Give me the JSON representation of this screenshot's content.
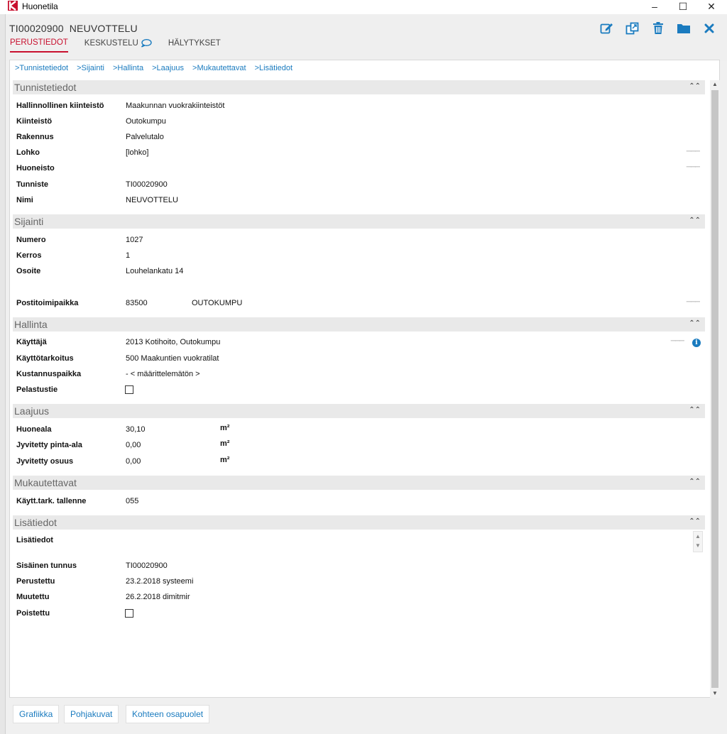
{
  "window": {
    "title": "Huonetila",
    "minimize": "–",
    "maximize": "☐",
    "close": "✕"
  },
  "record": {
    "code": "TI00020900",
    "name": "NEUVOTTELU"
  },
  "tabs": [
    "PERUSTIEDOT",
    "KESKUSTELU",
    "HÄLYTYKSET"
  ],
  "anchors": [
    ">Tunnistetiedot",
    ">Sijainti",
    ">Hallinta",
    ">Laajuus",
    ">Mukautettavat",
    ">Lisätiedot"
  ],
  "sections": {
    "tunnistetiedot": {
      "title": "Tunnistetiedot",
      "rows": [
        {
          "label": "Hallinnollinen kiinteistö",
          "value": "Maakunnan vuokrakiinteistöt"
        },
        {
          "label": "Kiinteistö",
          "value": "Outokumpu"
        },
        {
          "label": "Rakennus",
          "value": "Palvelutalo"
        },
        {
          "label": "Lohko",
          "value": "[lohko]"
        },
        {
          "label": "Huoneisto",
          "value": ""
        },
        {
          "label": "Tunniste",
          "value": "TI00020900"
        },
        {
          "label": "Nimi",
          "value": "NEUVOTTELU"
        }
      ]
    },
    "sijainti": {
      "title": "Sijainti",
      "rows": [
        {
          "label": "Numero",
          "value": "1027"
        },
        {
          "label": "Kerros",
          "value": "1"
        },
        {
          "label": "Osoite",
          "value": "Louhelankatu 14"
        },
        {
          "label": "Postitoimipaikka",
          "value": "83500",
          "value2": "OUTOKUMPU"
        }
      ]
    },
    "hallinta": {
      "title": "Hallinta",
      "rows": [
        {
          "label": "Käyttäjä",
          "value": "2013 Kotihoito, Outokumpu"
        },
        {
          "label": "Käyttötarkoitus",
          "value": "500 Maakuntien vuokratilat"
        },
        {
          "label": "Kustannuspaikka",
          "value": "- < määrittelemätön >"
        },
        {
          "label": "Pelastustie",
          "value": ""
        }
      ]
    },
    "laajuus": {
      "title": "Laajuus",
      "rows": [
        {
          "label": "Huoneala",
          "value": "30,10",
          "unit": "m²"
        },
        {
          "label": "Jyvitetty pinta-ala",
          "value": "0,00",
          "unit": "m²"
        },
        {
          "label": "Jyvitetty osuus",
          "value": "0,00",
          "unit": "m²"
        }
      ]
    },
    "mukautettavat": {
      "title": "Mukautettavat",
      "rows": [
        {
          "label": "Käytt.tark. tallenne",
          "value": "055"
        }
      ]
    },
    "lisatiedot": {
      "title": "Lisätiedot",
      "rows": [
        {
          "label": "Lisätiedot",
          "value": ""
        },
        {
          "label": "Sisäinen tunnus",
          "value": "TI00020900"
        },
        {
          "label": "Perustettu",
          "value": "23.2.2018  systeemi"
        },
        {
          "label": "Muutettu",
          "value": "26.2.2018  dimitmir"
        },
        {
          "label": "Poistettu",
          "value": ""
        }
      ]
    }
  },
  "footer": [
    "Grafiikka",
    "Pohjakuvat",
    "Kohteen osapuolet"
  ],
  "colors": {
    "accent": "#1a7bbf",
    "active_tab": "#c8102e",
    "section_bg": "#e9e9e9"
  },
  "icons": [
    "edit-icon",
    "copy-icon",
    "trash-icon",
    "folder-icon",
    "close-icon",
    "chat-bubble-icon",
    "info-icon"
  ]
}
